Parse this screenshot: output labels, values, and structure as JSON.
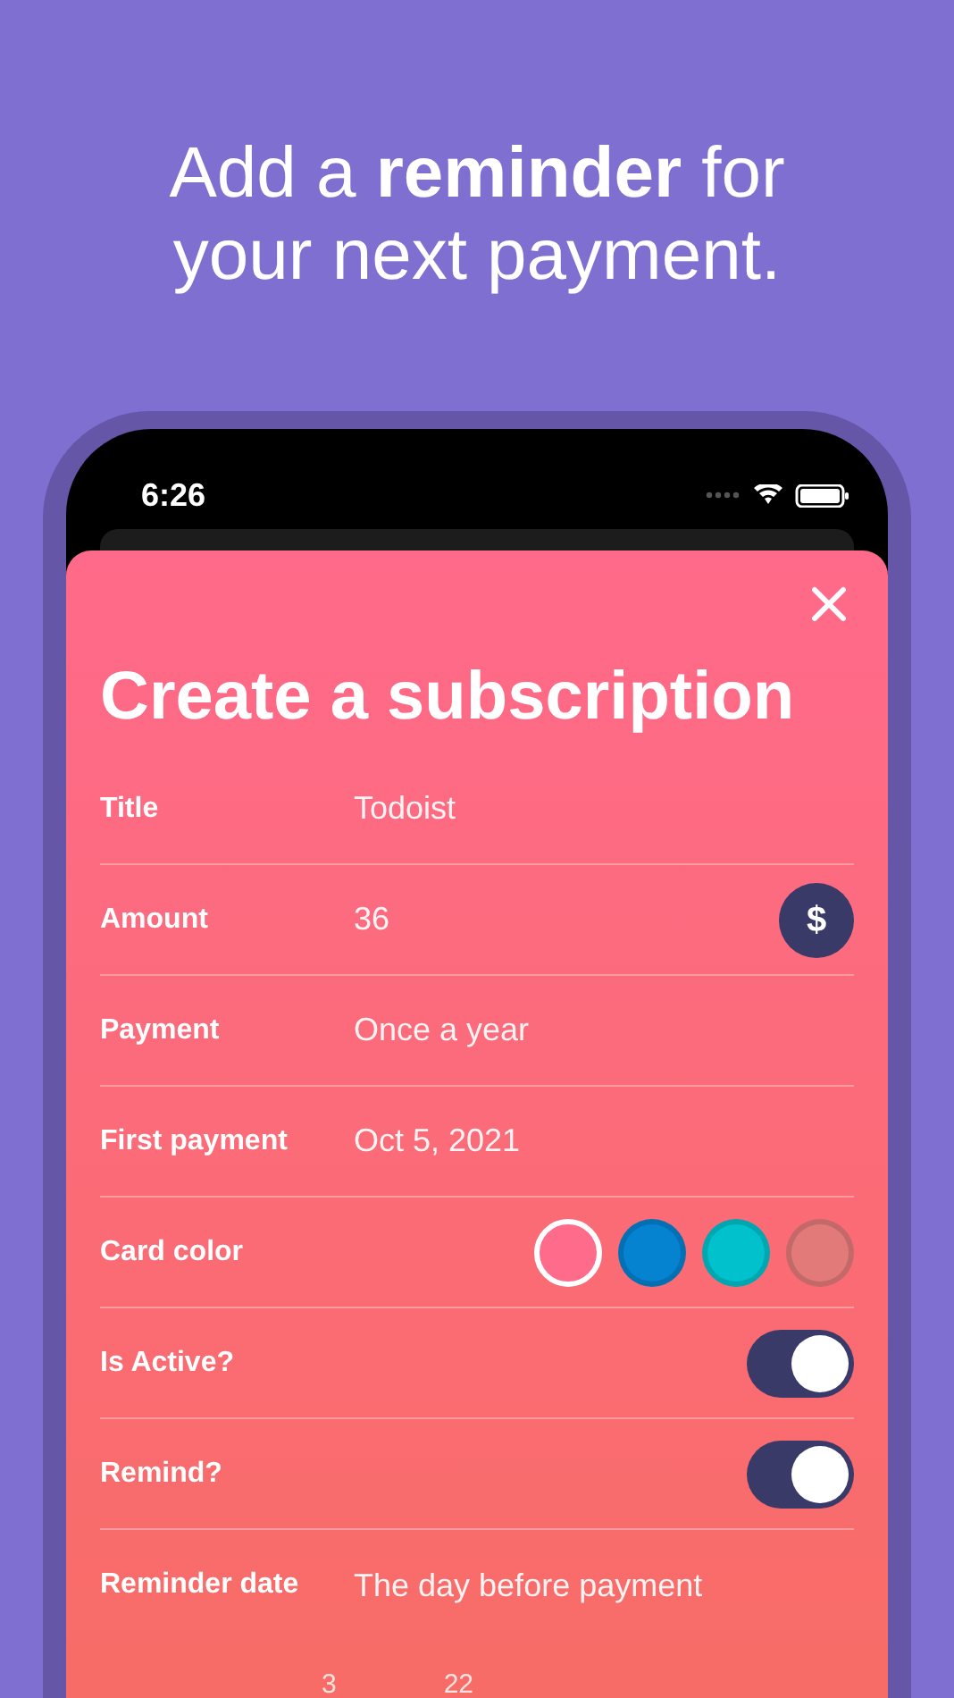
{
  "headline": "Add a **reminder** for your next payment.",
  "status_bar": {
    "time": "6:26"
  },
  "sheet": {
    "title": "Create a subscription",
    "rows": [
      {
        "kind": "text",
        "label": "Title",
        "value": "Todoist"
      },
      {
        "kind": "amount",
        "label": "Amount",
        "value": "36",
        "currency": "$"
      },
      {
        "kind": "text",
        "label": "Payment",
        "value": "Once a year"
      },
      {
        "kind": "text",
        "label": "First payment",
        "value": "Oct 5, 2021"
      },
      {
        "kind": "colors",
        "label": "Card color",
        "swatches": [
          {
            "color": "#ff6b8a",
            "selected": true
          },
          {
            "color": "#0582d0",
            "selected": false
          },
          {
            "color": "#00c1cc",
            "selected": false
          },
          {
            "color": "#e27a7a",
            "selected": false
          }
        ]
      },
      {
        "kind": "toggle",
        "label": "Is Active?",
        "on": true
      },
      {
        "kind": "toggle",
        "label": "Remind?",
        "on": true
      },
      {
        "kind": "text",
        "label": "Reminder date",
        "value": "The day before payment"
      }
    ],
    "picker": [
      "3",
      "22"
    ]
  }
}
